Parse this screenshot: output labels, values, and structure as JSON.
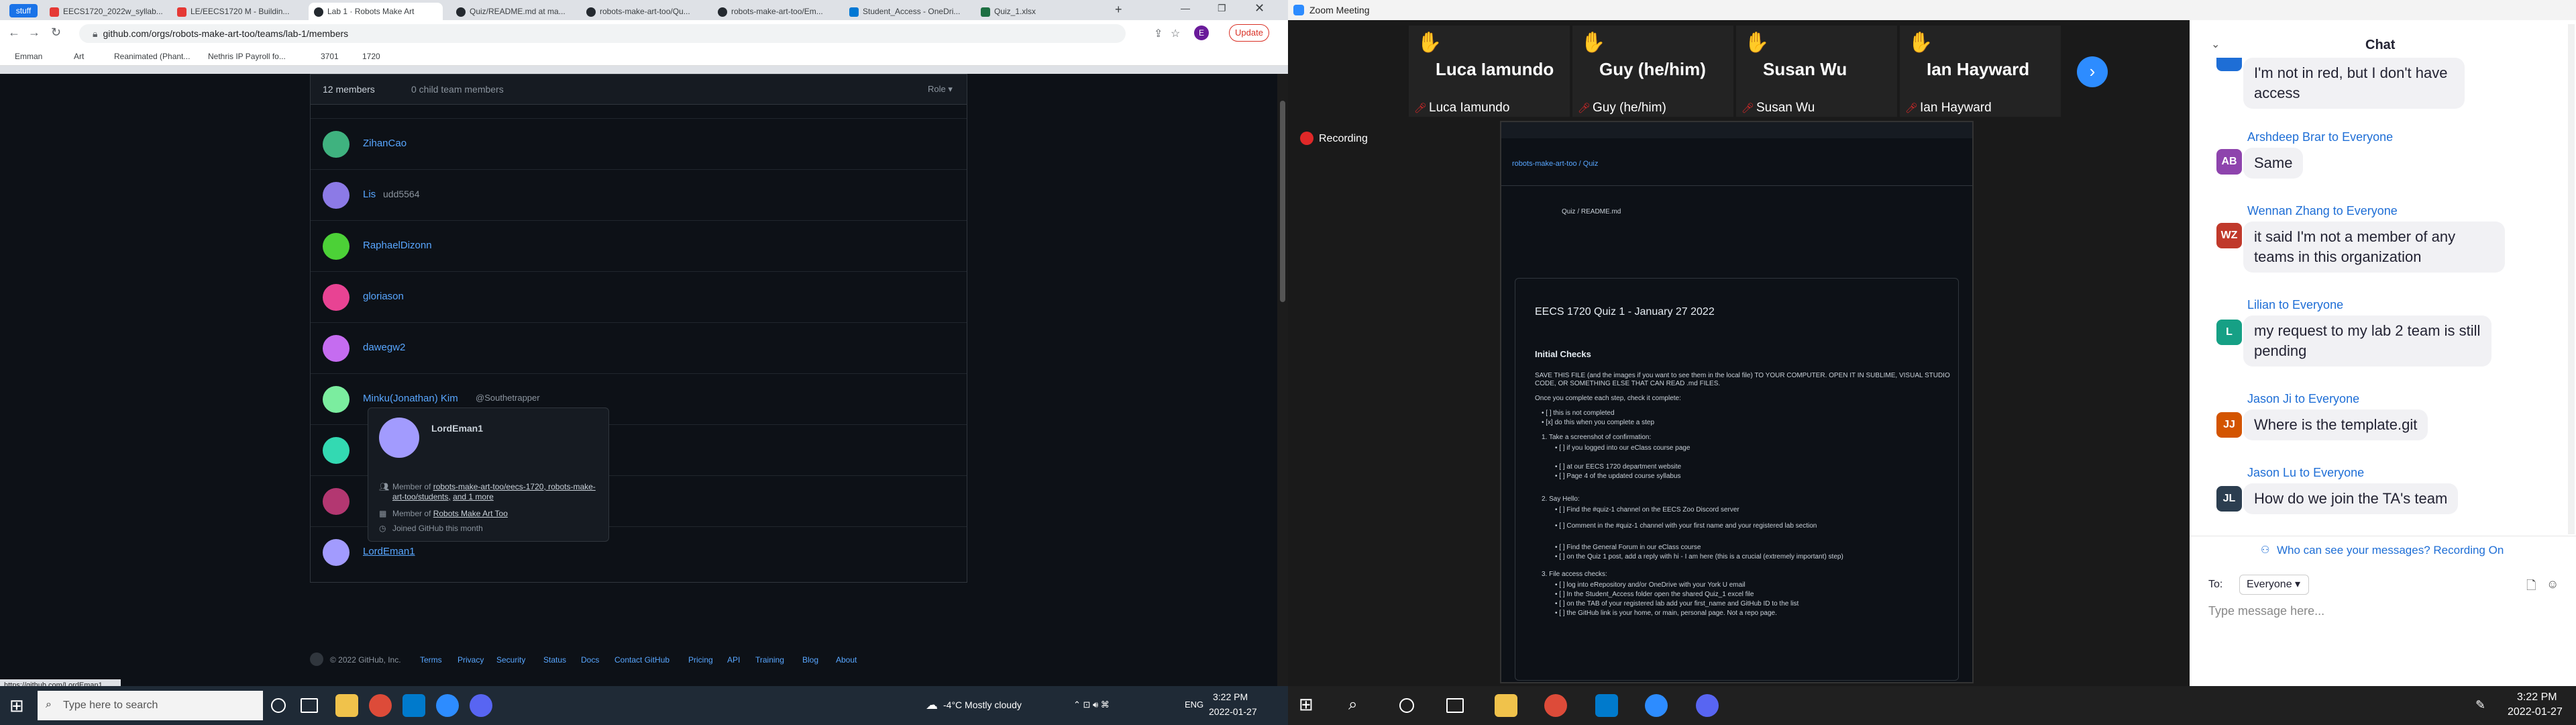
{
  "browser": {
    "tabs": [
      {
        "label": "stuff",
        "color": "#1a73e8"
      },
      {
        "label": "EECS1720_2022w_syllab...",
        "color": "#e53935"
      },
      {
        "label": "LE/EECS1720 M - Buildin...",
        "color": "#e53935"
      },
      {
        "label": "Lab 1 · Robots Make Art",
        "color": "#24292f",
        "active": true
      },
      {
        "label": "Quiz/README.md at ma...",
        "color": "#24292f"
      },
      {
        "label": "robots-make-art-too/Qu...",
        "color": "#24292f"
      },
      {
        "label": "robots-make-art-too/Em...",
        "color": "#24292f"
      },
      {
        "label": "Student_Access - OneDri...",
        "color": "#0078d4"
      },
      {
        "label": "Quiz_1.xlsx",
        "color": "#1d6f42"
      }
    ],
    "url": "github.com/orgs/robots-make-art-too/teams/lab-1/members",
    "update_label": "Update",
    "profile_initial": "E",
    "bookmarks": [
      "Emman",
      "Art",
      "Reanimated (Phant...",
      "Nethris IP Payroll fo...",
      "3701",
      "1720"
    ]
  },
  "github": {
    "header": {
      "members_label": "12 members",
      "child_label": "0 child team members",
      "role_label": "Role ▾"
    },
    "members": [
      {
        "name": "ZihanCao",
        "sub": "",
        "color": "#3fb27f"
      },
      {
        "name": "Lis",
        "sub": "udd5564",
        "color": "#8c7ae6"
      },
      {
        "name": "RaphaelDizonn",
        "sub": "",
        "color": "#4cd137"
      },
      {
        "name": "gloriason",
        "sub": "",
        "color": "#e84393"
      },
      {
        "name": "dawegw2",
        "sub": "",
        "color": "#c56cf0"
      },
      {
        "name": "Minku(Jonathan) Kim",
        "sub": "@Southetrapper",
        "color": "#7bed9f"
      },
      {
        "name": "",
        "sub": "",
        "color": "#33d9b2"
      },
      {
        "name": "",
        "sub": "",
        "color": "#b33771"
      },
      {
        "name": "LordEman1",
        "sub": "",
        "color": "#a29bfe"
      }
    ],
    "hovercard": {
      "name": "LordEman1",
      "member_prefix": "Member of",
      "member_links": "robots-make-art-too/eecs-1720, robots-make-art-too/students,",
      "more": "and 1 more",
      "member_of2_prefix": "Member of",
      "member_of2": "Robots Make Art Too",
      "joined": "Joined GitHub this month"
    },
    "footer": [
      "© 2022 GitHub, Inc.",
      "Terms",
      "Privacy",
      "Security",
      "Status",
      "Docs",
      "Contact GitHub",
      "Pricing",
      "API",
      "Training",
      "Blog",
      "About"
    ],
    "status_url": "https://github.com/LordEman1"
  },
  "zoom": {
    "title": "Zoom Meeting",
    "recording_label": "Recording",
    "participants": [
      {
        "big": "Luca Iamundo",
        "small": "Luca Iamundo"
      },
      {
        "big": "Guy (he/him)",
        "small": "Guy (he/him)"
      },
      {
        "big": "Susan Wu",
        "small": "Susan Wu"
      },
      {
        "big": "Ian Hayward",
        "small": "Ian Hayward"
      }
    ],
    "shared": {
      "repo": "robots-make-art-too / Quiz",
      "path": "Quiz / README.md",
      "doc_title": "EECS 1720 Quiz 1 - January 27 2022",
      "section": "Initial Checks",
      "lines": [
        "SAVE THIS FILE (and the images if you want to see them in the local file) TO YOUR COMPUTER. OPEN IT IN SUBLIME, VISUAL STUDIO",
        "CODE, OR SOMETHING ELSE THAT CAN READ .md FILES.",
        "Once you complete each step, check it complete:",
        "• [ ] this is not completed",
        "• [x] do this when you complete a step",
        "1. Take a screenshot of confirmation:",
        "• [ ] if you logged into our eClass course page",
        "• [ ] at our EECS 1720 department website",
        "• [ ] Page 4 of the updated course syllabus",
        "2. Say Hello:",
        "• [ ] Find the #quiz-1 channel on the EECS Zoo Discord server",
        "• [ ] Comment in the #quiz-1 channel with your first name and your registered lab section",
        "• [ ] Find the General Forum in our eClass course",
        "• [ ] on the Quiz 1 post, add a reply with hi - I am here (this is a crucial (extremely important) step)",
        "3. File access checks:",
        "• [ ] log into eRepository and/or OneDrive with your York U email",
        "• [ ] In the Student_Access folder open the shared Quiz_1 excel file",
        "• [ ] on the TAB of your registered lab add your first_name and GitHub ID to the list",
        "• [ ] the GitHub link is your home, or main, personal page. Not a repo page."
      ]
    }
  },
  "chat": {
    "title": "Chat",
    "messages": [
      {
        "avatar": "",
        "color": "#1e6ed6",
        "from": "",
        "text": "I'm not in red, but I don't have access"
      },
      {
        "avatar": "AB",
        "color": "#8e44ad",
        "from": "Arshdeep Brar to Everyone",
        "text": "Same"
      },
      {
        "avatar": "WZ",
        "color": "#c0392b",
        "from": "Wennan Zhang to Everyone",
        "text": "it said I'm not a member of any teams in this organization"
      },
      {
        "avatar": "L",
        "color": "#16a085",
        "from": "Lilian to Everyone",
        "text": "my request to my lab 2 team is still pending"
      },
      {
        "avatar": "JJ",
        "color": "#d35400",
        "from": "Jason Ji to Everyone",
        "text": "Where is the template.git"
      },
      {
        "avatar": "JL",
        "color": "#2c3e50",
        "from": "Jason Lu to Everyone",
        "text": "How do we join the TA's team"
      }
    ],
    "visibility_note": "Who can see your messages? Recording On",
    "to_label": "To:",
    "to_value": "Everyone",
    "input_placeholder": "Type message here..."
  },
  "taskbar": {
    "search_placeholder": "Type here to search",
    "weather": "-4°C  Mostly cloudy",
    "lang": "ENG",
    "time_left": "3:22 PM",
    "date_left": "2022-01-27",
    "time_right": "3:22 PM",
    "date_right": "2022-01-27"
  }
}
